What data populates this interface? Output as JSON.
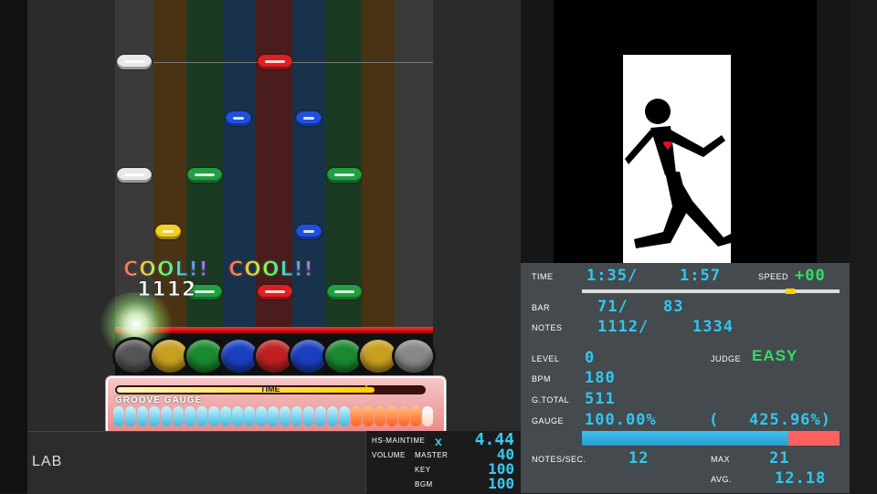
{
  "judge": {
    "text1": "COOL!!",
    "text2": "COOL!!",
    "combo": "1112"
  },
  "gauge_panel": {
    "time_label": "TIME",
    "groove_label": "GROOVE GAUGE",
    "time_progress": 0.84,
    "groove_level": 0.74
  },
  "footer": {
    "lab": "LAB"
  },
  "hs_panel": {
    "hs_label": "HS-MAINTIME",
    "hs_mult": "x",
    "hs_value": "4.44",
    "volume_label": "VOLUME",
    "master_label": "MASTER",
    "master_value": "40",
    "key_label": "KEY",
    "key_value": "100",
    "bgm_label": "BGM",
    "bgm_value": "100"
  },
  "info": {
    "time_label": "TIME",
    "time_value": "1:35/",
    "time_total": "1:57",
    "speed_label": "SPEED",
    "speed_value": "+00",
    "bar_label": "BAR",
    "bar_value": "71/",
    "bar_total": "83",
    "notes_label": "NOTES",
    "notes_value": "1112/",
    "notes_total": "1334",
    "level_label": "LEVEL",
    "level_value": "0",
    "judge_label": "JUDGE",
    "judge_value": "EASY",
    "bpm_label": "BPM",
    "bpm_value": "180",
    "gtotal_label": "G.TOTAL",
    "gtotal_value": "511",
    "gauge_label": "GAUGE",
    "gauge_value": "100.00%",
    "gauge_ext_open": "(",
    "gauge_ext_value": "425.96%)",
    "nps_label": "NOTES/SEC.",
    "nps_value": "12",
    "max_label": "MAX",
    "max_value": "21",
    "avg_label": "AVG.",
    "avg_value": "12.18",
    "song_progress": 0.81,
    "gauge_fill": 0.8
  },
  "colors": {
    "cyan": "#30c8f0",
    "easy": "#30e060",
    "judge_line": "#e02020"
  }
}
